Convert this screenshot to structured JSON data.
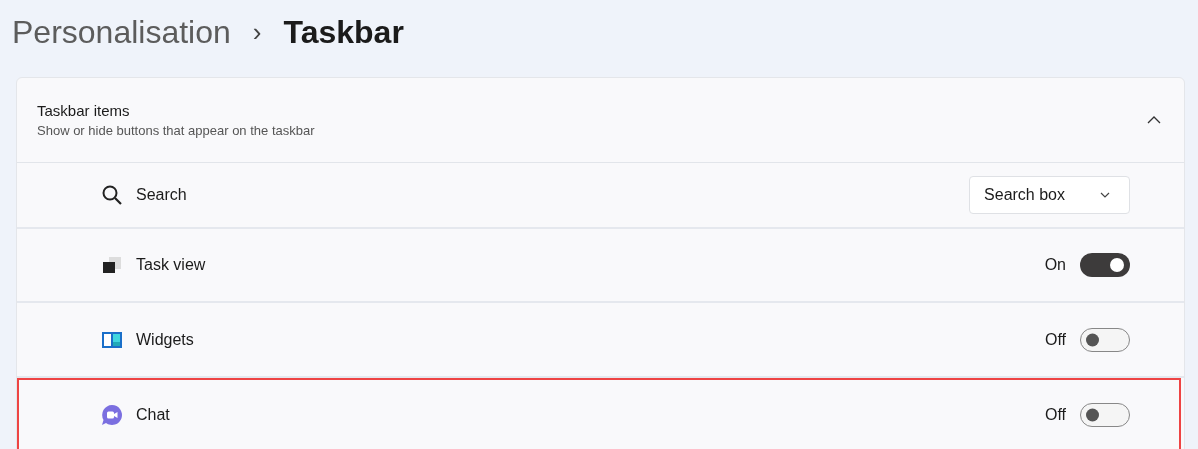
{
  "breadcrumb": {
    "parent": "Personalisation",
    "separator": "›",
    "current": "Taskbar"
  },
  "section": {
    "title": "Taskbar items",
    "subtitle": "Show or hide buttons that appear on the taskbar",
    "expanded": true
  },
  "items": [
    {
      "kind": "dropdown",
      "label": "Search",
      "value": "Search box",
      "highlighted": false
    },
    {
      "kind": "toggle",
      "label": "Task view",
      "state_label": "On",
      "on": true,
      "highlighted": false
    },
    {
      "kind": "toggle",
      "label": "Widgets",
      "state_label": "Off",
      "on": false,
      "highlighted": false
    },
    {
      "kind": "toggle",
      "label": "Chat",
      "state_label": "Off",
      "on": false,
      "highlighted": true
    }
  ]
}
